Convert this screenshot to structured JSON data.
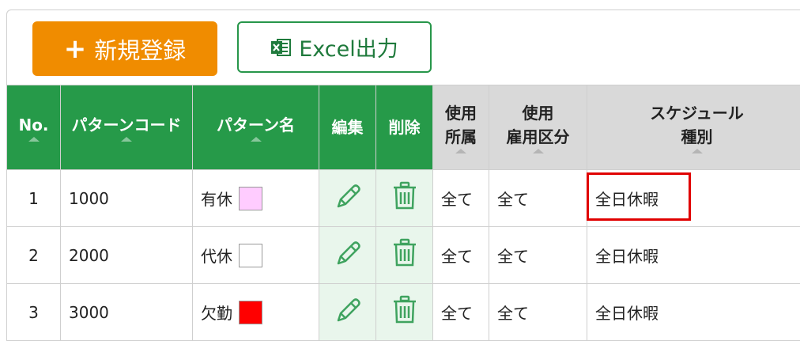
{
  "toolbar": {
    "new_label": "新規登録",
    "excel_label": "Excel出力"
  },
  "table": {
    "headers": {
      "no": "No.",
      "code": "パターンコード",
      "name": "パターン名",
      "edit": "編集",
      "delete": "削除",
      "use_dept_1": "使用",
      "use_dept_2": "所属",
      "use_emp_1": "使用",
      "use_emp_2": "雇用区分",
      "sched_1": "スケジュール",
      "sched_2": "種別"
    },
    "rows": [
      {
        "no": "1",
        "code": "1000",
        "name": "有休",
        "color": "#ffccff",
        "dept": "全て",
        "emp": "全て",
        "schedule": "全日休暇"
      },
      {
        "no": "2",
        "code": "2000",
        "name": "代休",
        "color": "#ffffff",
        "dept": "全て",
        "emp": "全て",
        "schedule": "全日休暇"
      },
      {
        "no": "3",
        "code": "3000",
        "name": "欠勤",
        "color": "#ff0000",
        "dept": "全て",
        "emp": "全て",
        "schedule": "全日休暇"
      }
    ]
  },
  "colors": {
    "accent_orange": "#f08c00",
    "header_green": "#269a49",
    "highlight_red": "#e00000"
  },
  "icons": {
    "edit": "pencil-icon",
    "delete": "trash-icon",
    "add": "plus-icon",
    "excel": "excel-icon"
  }
}
